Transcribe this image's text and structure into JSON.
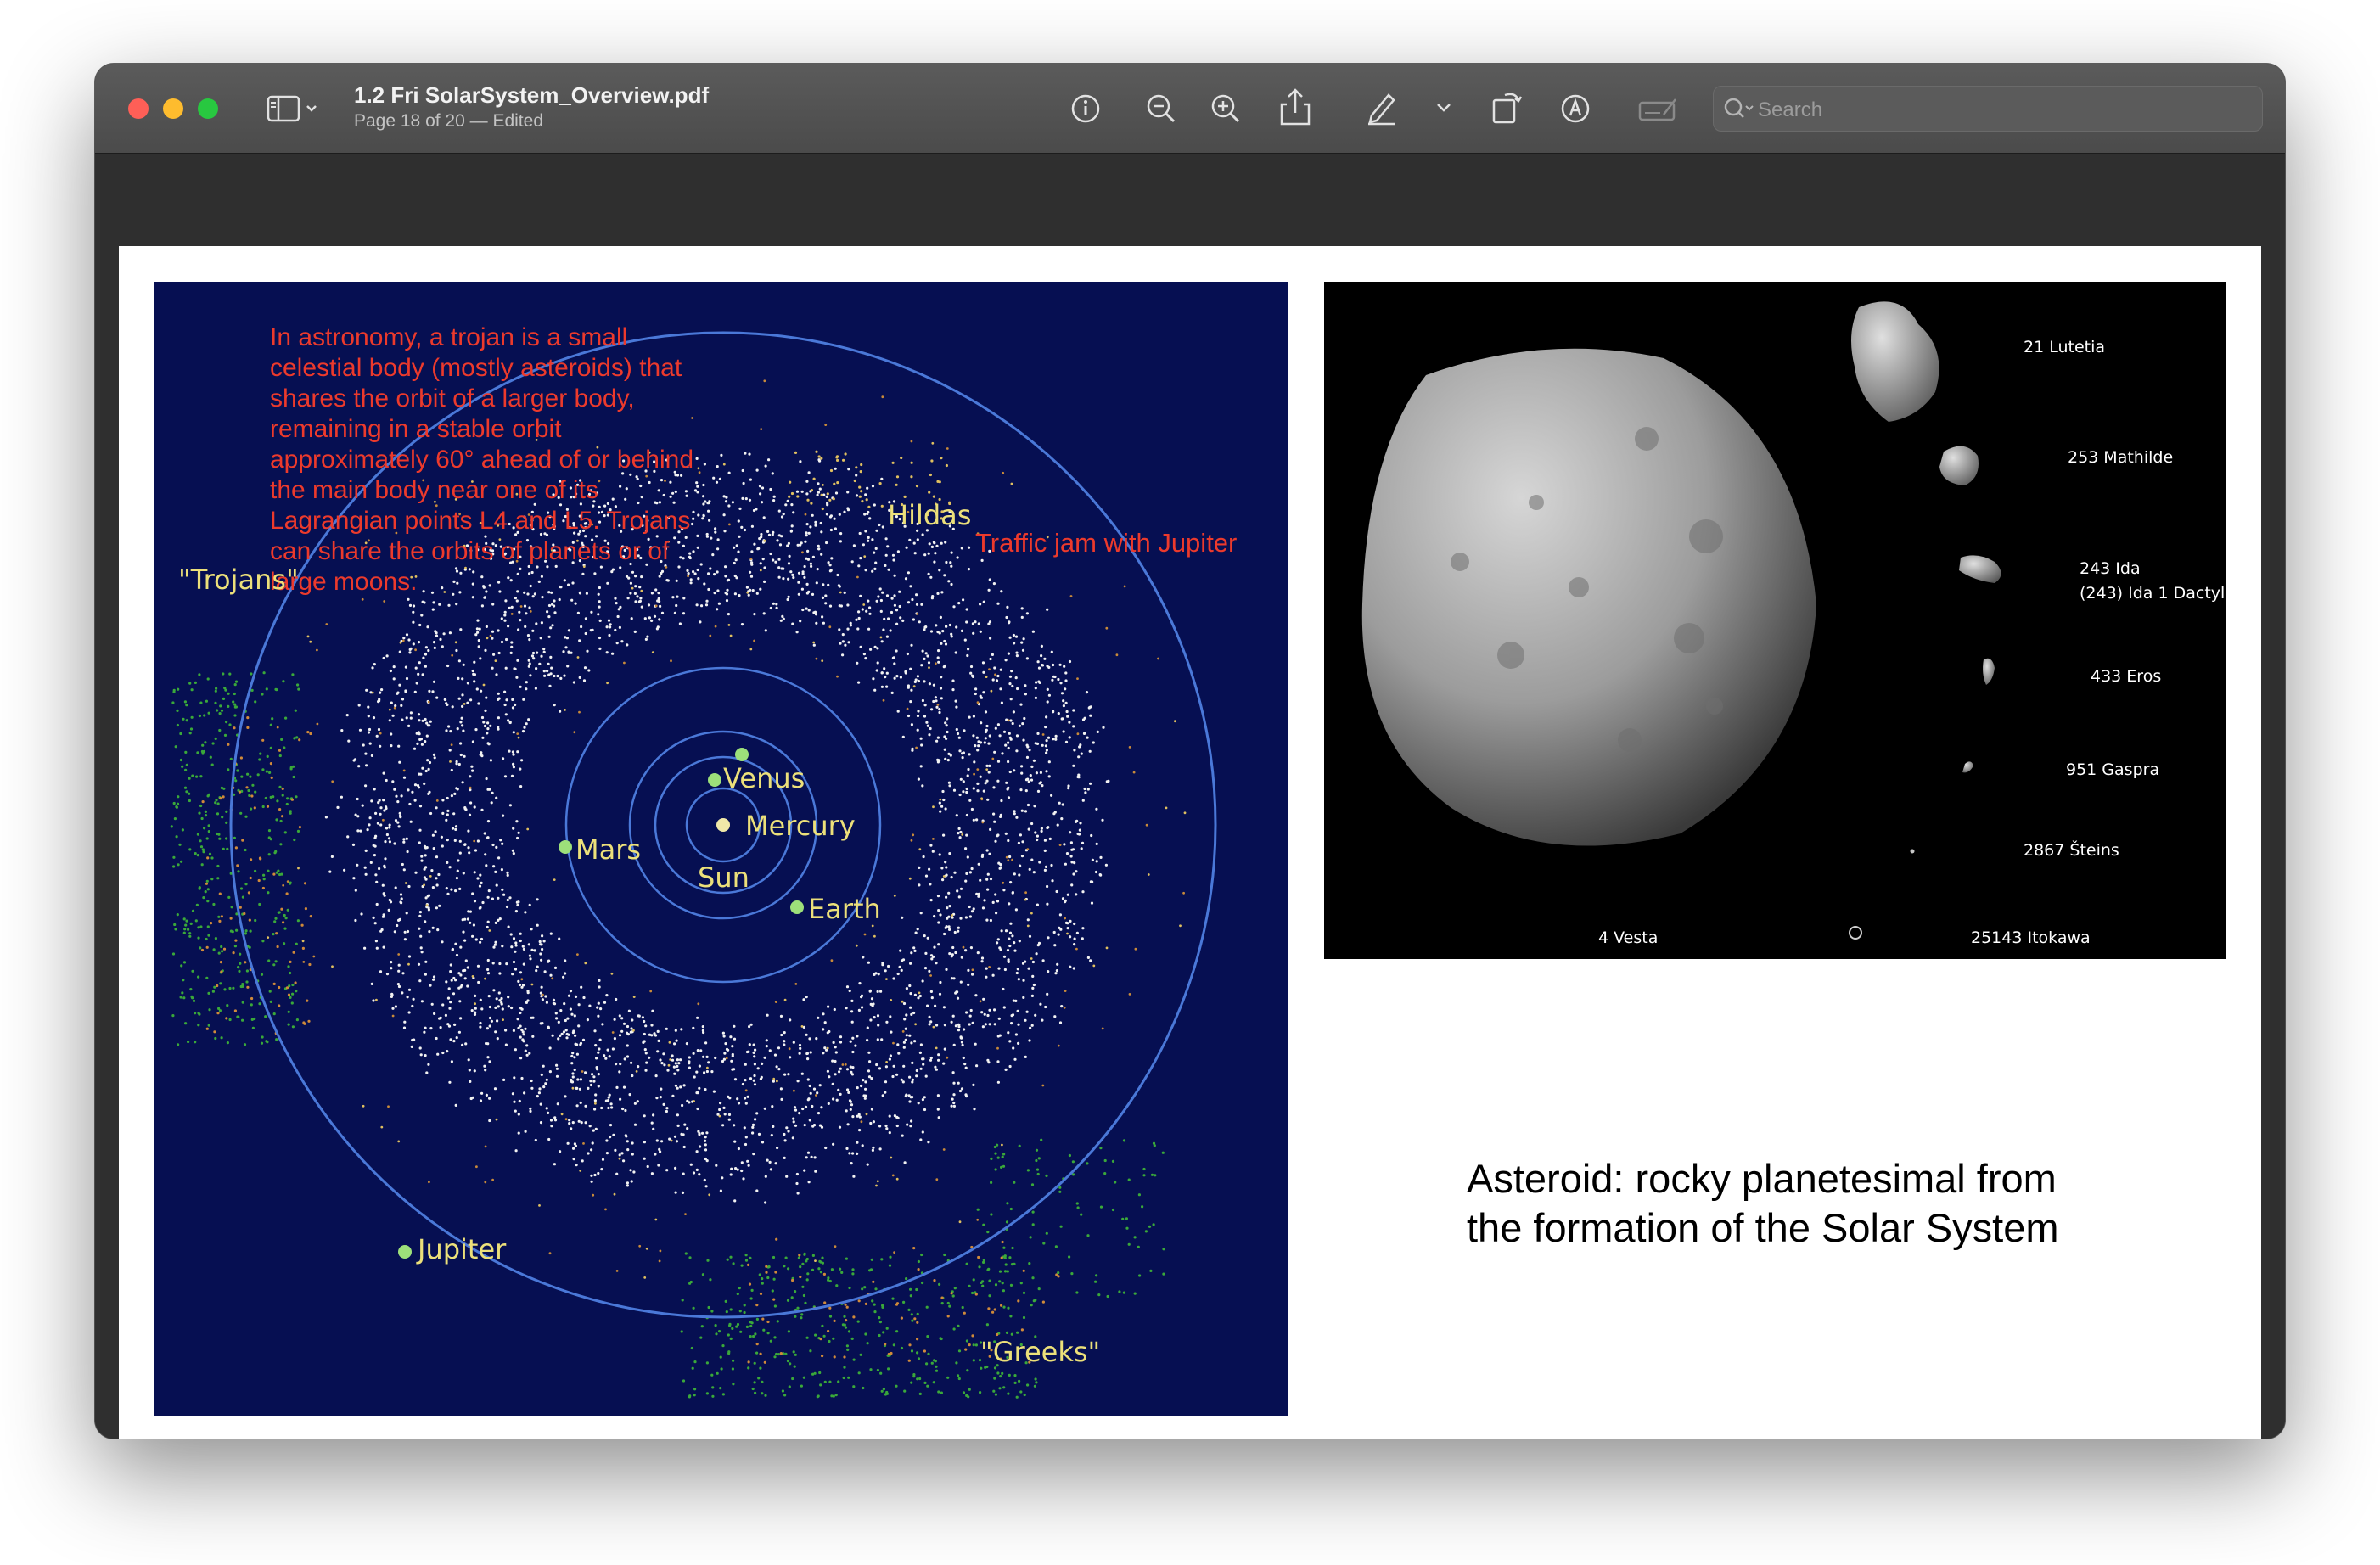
{
  "window": {
    "title": "1.2 Fri SolarSystem_Overview.pdf",
    "subtitle": "Page 18 of 20 — Edited"
  },
  "toolbar": {
    "sidebar_toggle": "sidebar-icon",
    "buttons": [
      "info-icon",
      "zoom-out-icon",
      "zoom-in-icon",
      "share-icon",
      "markup-pen-icon",
      "chevron-down-icon",
      "rotate-icon",
      "markup-icon",
      "form-fill-icon"
    ],
    "search_placeholder": "Search"
  },
  "diagram": {
    "trojan_definition": "In astronomy, a trojan is a small\ncelestial body (mostly asteroids) that\nshares the orbit of a larger body,\nremaining in a stable orbit\napproximately 60° ahead of or behind\nthe main body near one of its\nLagrangian points L4 and L5. Trojans\ncan share the orbits of planets or of\nlarge moons.",
    "traffic_jam": "Traffic jam with Jupiter",
    "hildas": "Hildas",
    "trojans": "\"Trojans\"",
    "greeks": "\"Greeks\"",
    "venus": "Venus",
    "mercury": "Mercury",
    "mars": "Mars",
    "sun": "Sun",
    "earth": "Earth",
    "jupiter": "Jupiter",
    "colors": {
      "background": "#060f52",
      "orbit": "#4a78d8",
      "annotation": "#ec3a2c",
      "label": "#ece07a",
      "trojan_dots": "#3aa83a"
    }
  },
  "asteroids": {
    "labels": [
      "21 Lutetia",
      "253 Mathilde",
      "243 Ida",
      "(243) Ida 1 Dactyl",
      "433 Eros",
      "951 Gaspra",
      "2867 Šteins",
      "4 Vesta",
      "25143 Itokawa"
    ]
  },
  "caption": "Asteroid: rocky planetesimal from\nthe formation of the Solar System"
}
